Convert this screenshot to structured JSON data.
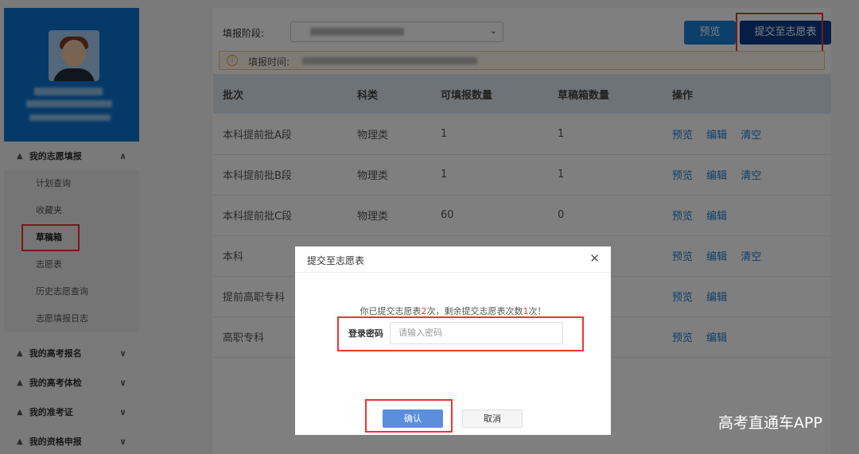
{
  "sidebar": {
    "groups": [
      {
        "label": "我的志愿填报",
        "items": [
          {
            "label": "计划查询"
          },
          {
            "label": "收藏夹"
          },
          {
            "label": "草稿箱"
          },
          {
            "label": "志愿表"
          },
          {
            "label": "历史志愿查询"
          },
          {
            "label": "志愿填报日志"
          }
        ]
      },
      {
        "label": "我的高考报名"
      },
      {
        "label": "我的高考体检"
      },
      {
        "label": "我的准考证"
      },
      {
        "label": "我的资格申报"
      }
    ]
  },
  "toolbar": {
    "stage_label": "填报阶段:",
    "preview_label": "预览",
    "submit_label": "提交至志愿表"
  },
  "notice": {
    "icon": "info-circle-icon",
    "label": "填报时间:"
  },
  "table": {
    "headers": [
      "批次",
      "科类",
      "可填报数量",
      "草稿箱数量",
      "操作"
    ],
    "rows": [
      {
        "batch": "本科提前批A段",
        "subject": "物理类",
        "available": "1",
        "draft": "1",
        "op_preview": "预览",
        "op_edit": "编辑",
        "op_clear": "清空"
      },
      {
        "batch": "本科提前批B段",
        "subject": "物理类",
        "available": "1",
        "draft": "1",
        "op_preview": "预览",
        "op_edit": "编辑",
        "op_clear": "清空"
      },
      {
        "batch": "本科提前批C段",
        "subject": "物理类",
        "available": "60",
        "draft": "0",
        "op_preview": "预览",
        "op_edit": "编辑"
      },
      {
        "batch": "本科",
        "op_preview": "预览",
        "op_edit": "编辑",
        "op_clear": "清空"
      },
      {
        "batch": "提前高职专科",
        "op_preview": "预览",
        "op_edit": "编辑"
      },
      {
        "batch": "高职专科",
        "op_preview": "预览",
        "op_edit": "编辑"
      }
    ]
  },
  "modal": {
    "title": "提交至志愿表",
    "msg_part1": "你已提交志愿表",
    "msg_count1": "2",
    "msg_part2": "次，剩余提交志愿表次数",
    "msg_count2": "1",
    "msg_part3": "次！",
    "password_label": "登录密码",
    "password_placeholder": "请输入密码",
    "confirm_label": "确认",
    "cancel_label": "取消"
  },
  "watermark": "高考直通车APP",
  "colors": {
    "brand_blue": "#0b74d0",
    "submit_dark": "#0d3d8a",
    "highlight_red": "#e33333",
    "link_blue": "#1a7fd6"
  }
}
